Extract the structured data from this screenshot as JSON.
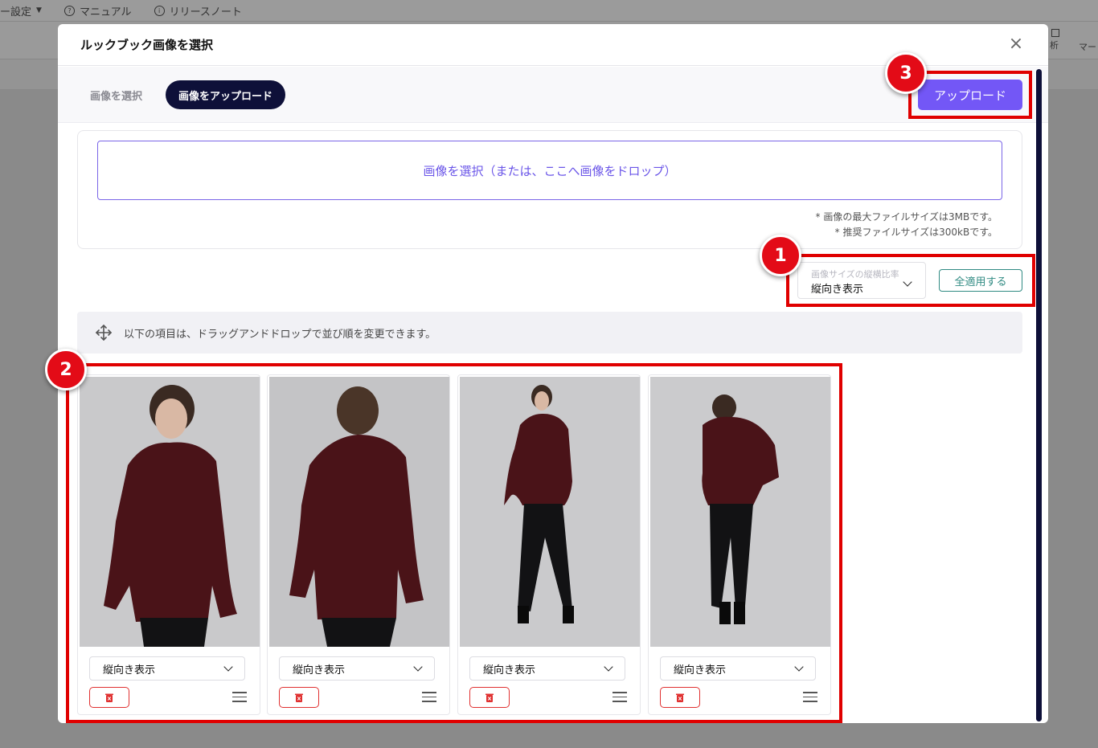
{
  "background": {
    "menu_items": [
      {
        "icon": "",
        "label": "ー設定",
        "has_caret": true
      },
      {
        "icon": "?",
        "label": "マニュアル"
      },
      {
        "icon": "i",
        "label": "リリースノート"
      }
    ],
    "right_labels": [
      "析",
      "マー"
    ]
  },
  "modal": {
    "title": "ルックブック画像を選択",
    "close_glyph": "×",
    "tabs": [
      {
        "label": "画像を選択",
        "active": false
      },
      {
        "label": "画像をアップロード",
        "active": true
      }
    ],
    "upload_button": "アップロード",
    "dropzone_text": "画像を選択（または、ここへ画像をドロップ）",
    "notes": [
      "* 画像の最大ファイルサイズは3MBです。",
      "* 推奨ファイルサイズは300kBです。"
    ],
    "ratio": {
      "label": "画像サイズの縦横比率",
      "value": "縦向き表示"
    },
    "apply_all_button": "全適用する",
    "hint_text": "以下の項目は、ドラッグアンドドロップで並び順を変更できます。",
    "cards": [
      {
        "ratio_value": "縦向き表示",
        "pose": "front"
      },
      {
        "ratio_value": "縦向き表示",
        "pose": "back"
      },
      {
        "ratio_value": "縦向き表示",
        "pose": "full-front"
      },
      {
        "ratio_value": "縦向き表示",
        "pose": "full-back"
      }
    ]
  },
  "annotations": [
    {
      "number": "1"
    },
    {
      "number": "2"
    },
    {
      "number": "3"
    }
  ],
  "colors": {
    "primary": "#7357f6",
    "navy": "#0e1039",
    "teal": "#2f8a82",
    "danger": "#e03030",
    "annotation_red": "#e00000",
    "sweater": "#4a1318"
  }
}
